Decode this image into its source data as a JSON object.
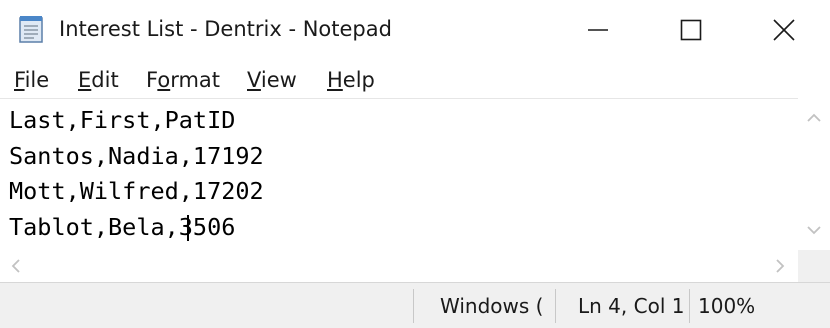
{
  "window": {
    "title": "Interest List - Dentrix - Notepad",
    "app_icon": "notepad-icon",
    "controls": {
      "minimize": "minimize-icon",
      "maximize": "maximize-icon",
      "close": "close-icon"
    }
  },
  "menu": {
    "file": {
      "mnemonic": "F",
      "rest": "ile"
    },
    "edit": {
      "mnemonic": "E",
      "rest": "dit"
    },
    "format": {
      "pre": "F",
      "mnemonic": "o",
      "rest": "rmat"
    },
    "view": {
      "mnemonic": "V",
      "rest": "iew"
    },
    "help": {
      "mnemonic": "H",
      "rest": "elp"
    }
  },
  "editor": {
    "content": "Last,First,PatID\nSantos,Nadia,17192\nMott,Wilfred,17202\nTablot,Bela,3506"
  },
  "scrollbars": {
    "up": "chevron-up-icon",
    "down": "chevron-down-icon",
    "left": "chevron-left-icon",
    "right": "chevron-right-icon"
  },
  "status": {
    "encoding": "Windows (",
    "position": "Ln 4, Col 1",
    "zoom": "100%"
  }
}
